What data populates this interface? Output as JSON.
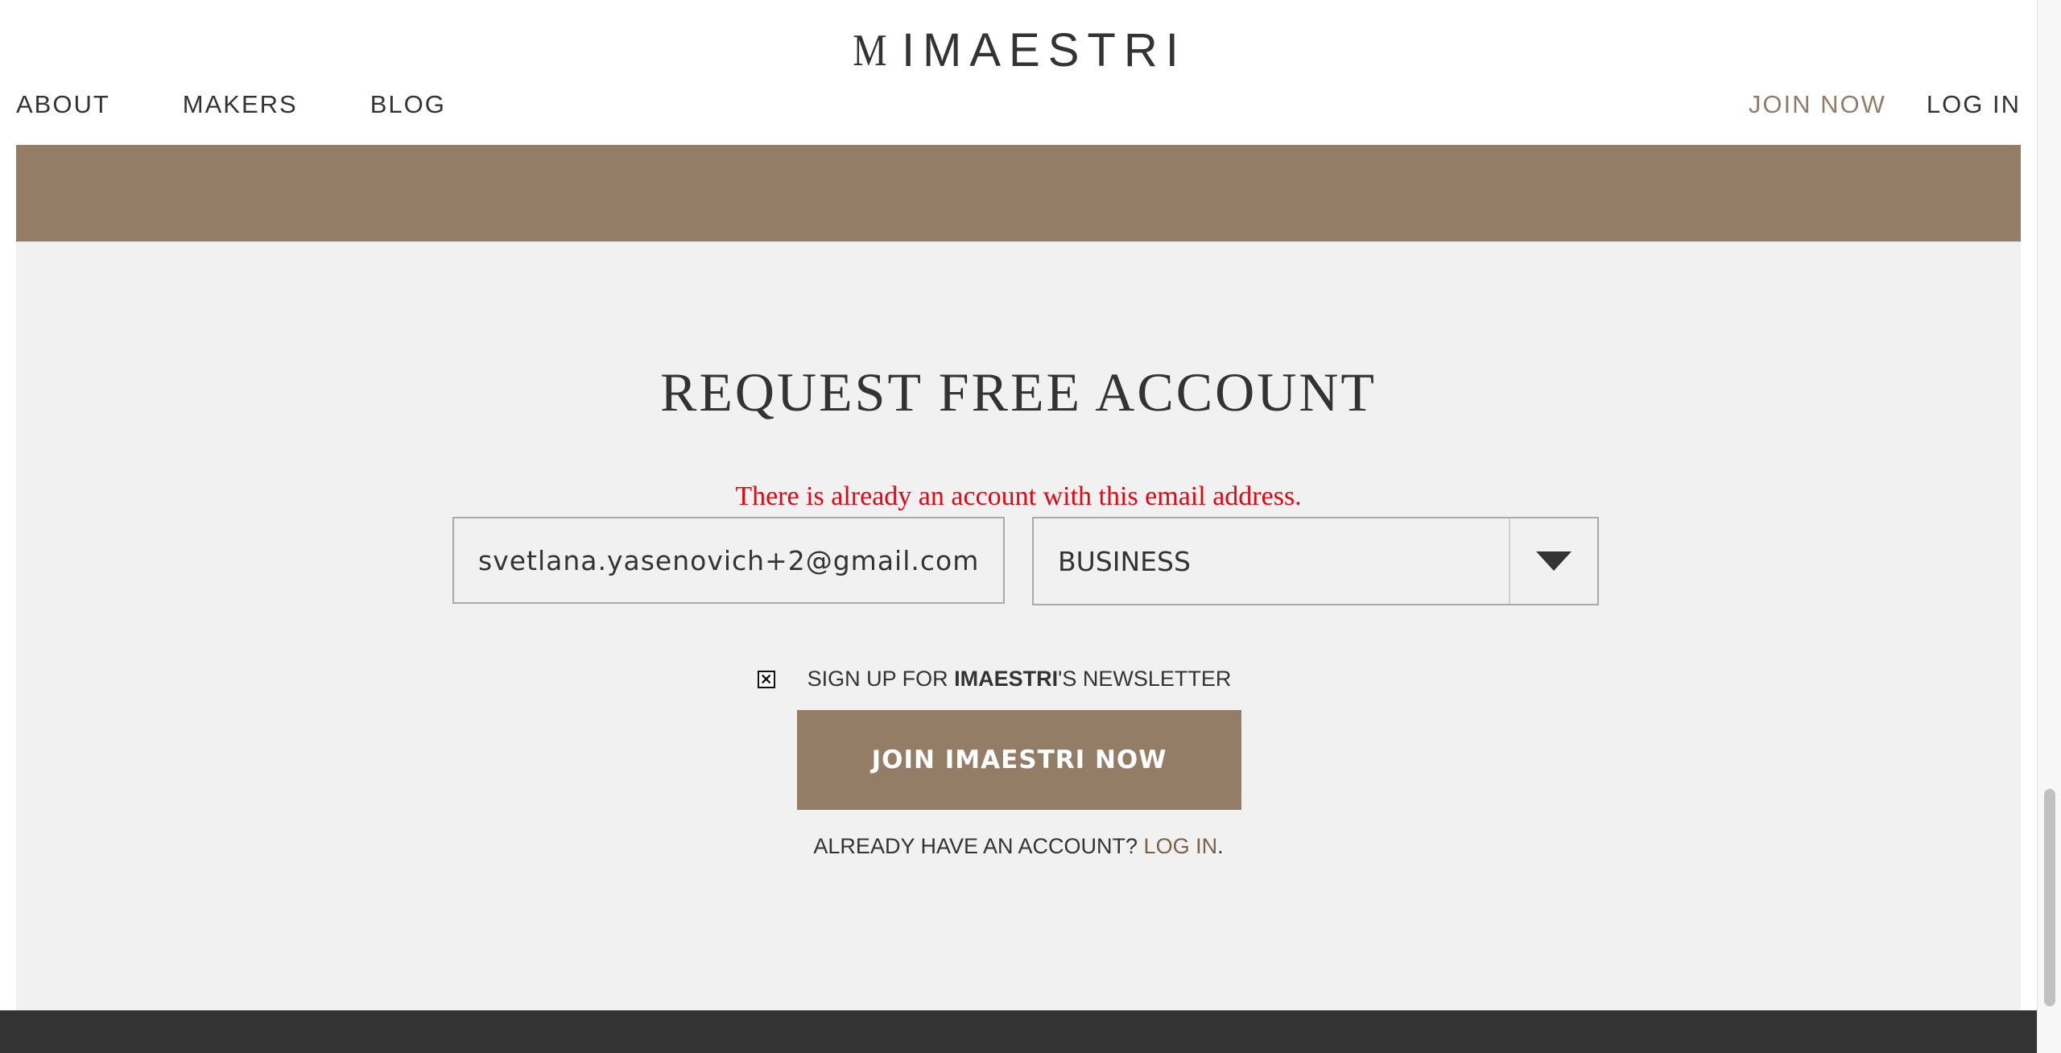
{
  "header": {
    "logo_mark": "M",
    "logo_text": "IMAESTRI",
    "nav_left": [
      {
        "label": "ABOUT"
      },
      {
        "label": "MAKERS"
      },
      {
        "label": "BLOG"
      }
    ],
    "nav_right": [
      {
        "label": "JOIN NOW"
      },
      {
        "label": "LOG IN"
      }
    ]
  },
  "form": {
    "title": "REQUEST FREE ACCOUNT",
    "error": "There is already an account with this email address.",
    "email_value": "svetlana.yasenovich+2@gmail.com",
    "account_type": "BUSINESS",
    "newsletter_prefix": "SIGN UP FOR ",
    "newsletter_brand": "IMAESTRI",
    "newsletter_suffix": "'S NEWSLETTER",
    "newsletter_checked": true,
    "join_button": "JOIN IMAESTRI NOW",
    "already_text": "ALREADY HAVE AN ACCOUNT? ",
    "login_link": "LOG IN",
    "login_trail": "."
  },
  "colors": {
    "accent": "#947d67",
    "error": "#e30613",
    "panel_bg": "#f1f1f1",
    "footer_bg": "#333333"
  }
}
